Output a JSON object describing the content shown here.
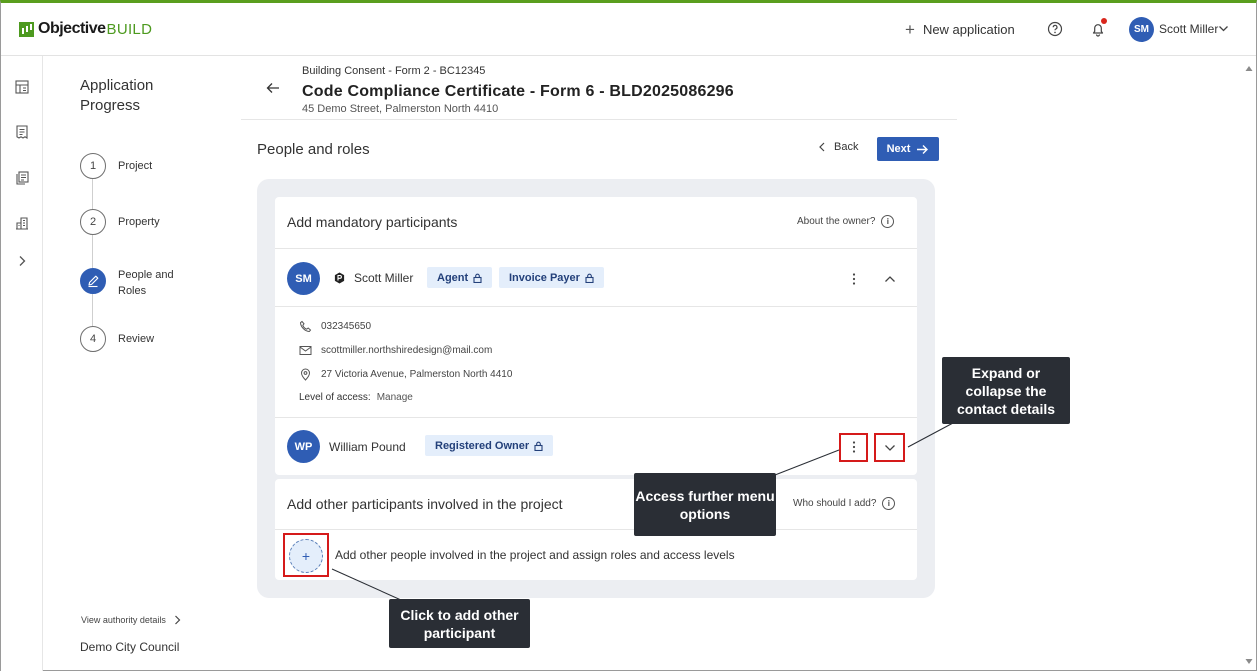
{
  "header": {
    "logo_obj": "Objective",
    "logo_build": "BUILD",
    "new_application": "New application",
    "user_initials": "SM",
    "user_name": "Scott Miller"
  },
  "progress": {
    "title": "Application Progress",
    "steps": [
      {
        "number": "1",
        "label": "Project"
      },
      {
        "number": "2",
        "label": "Property"
      },
      {
        "number": "",
        "label": "People and Roles"
      },
      {
        "number": "4",
        "label": "Review"
      }
    ],
    "authority_link": "View authority details",
    "council": "Demo City Council"
  },
  "main": {
    "breadcrumb": "Building Consent - Form 2 - BC12345",
    "title": "Code Compliance Certificate - Form 6 - BLD2025086296",
    "address": "45 Demo Street, Palmerston North 4410",
    "section": "People and roles",
    "back_label": "Back",
    "next_label": "Next"
  },
  "mandatory": {
    "heading": "Add mandatory participants",
    "help": "About the owner?",
    "participants": [
      {
        "initials": "SM",
        "name": "Scott Miller",
        "roles": [
          "Agent",
          "Invoice Payer"
        ],
        "phone": "032345650",
        "email": "scottmiller.northshiredesign@mail.com",
        "address": "27 Victoria Avenue, Palmerston North 4410",
        "access_label": "Level of access:",
        "access_value": "Manage"
      },
      {
        "initials": "WP",
        "name": "William Pound",
        "roles": [
          "Registered Owner"
        ]
      }
    ]
  },
  "others": {
    "heading": "Add other participants involved in the project",
    "help": "Who should I add?",
    "add_text": "Add other people involved in the project and assign roles and access levels",
    "add_symbol": "+"
  },
  "callouts": {
    "expand": "Expand or collapse the contact details",
    "menu": "Access further menu options",
    "add": "Click to add other participant"
  },
  "colors": {
    "accent": "#2f5db4",
    "brand": "#4d9a1f",
    "tag_bg": "#e4eefb",
    "callout_bg": "#2a2e35",
    "highlight": "#d51a1a"
  }
}
